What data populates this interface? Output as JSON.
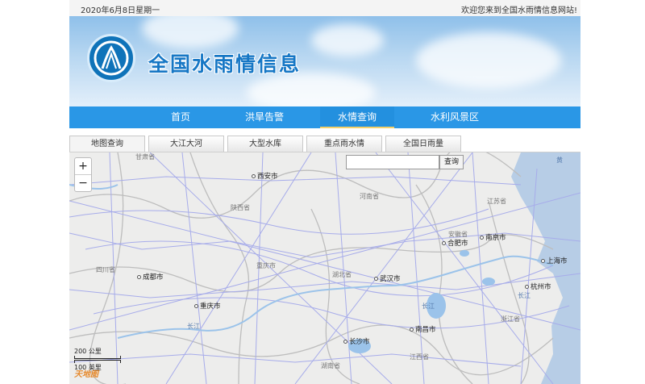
{
  "topbar": {
    "date": "2020年6月8日星期一",
    "welcome": "欢迎您来到全国水雨情信息网站!"
  },
  "header": {
    "title": "全国水雨情信息"
  },
  "nav": {
    "items": [
      "首页",
      "洪旱告警",
      "水情查询",
      "水利风景区"
    ],
    "active": "水情查询"
  },
  "tabs": {
    "items": [
      "地图查询",
      "大江大河",
      "大型水库",
      "重点雨水情",
      "全国日雨量"
    ],
    "active": "地图查询"
  },
  "map": {
    "zoom_in": "+",
    "zoom_out": "−",
    "search_value": "",
    "search_button": "查询",
    "scale_km": "200 公里",
    "scale_mi": "100 英里",
    "brand": "天地图",
    "cities": [
      "西安市",
      "合肥市",
      "南京市",
      "上海市",
      "成都市",
      "武汉市",
      "杭州市",
      "重庆市",
      "南昌市",
      "长沙市"
    ],
    "provinces": [
      "甘肃省",
      "陕西省",
      "河南省",
      "江苏省",
      "安徽省",
      "四川省",
      "重庆市",
      "湖北省",
      "浙江省",
      "江西省",
      "湖南省"
    ],
    "water_labels": [
      "黄",
      "长江",
      "长江",
      "长江"
    ],
    "colors": {
      "nav": "#2a97e6",
      "title": "#1677c5",
      "road": "#9aa0e6",
      "sea": "#b7cde6"
    }
  }
}
